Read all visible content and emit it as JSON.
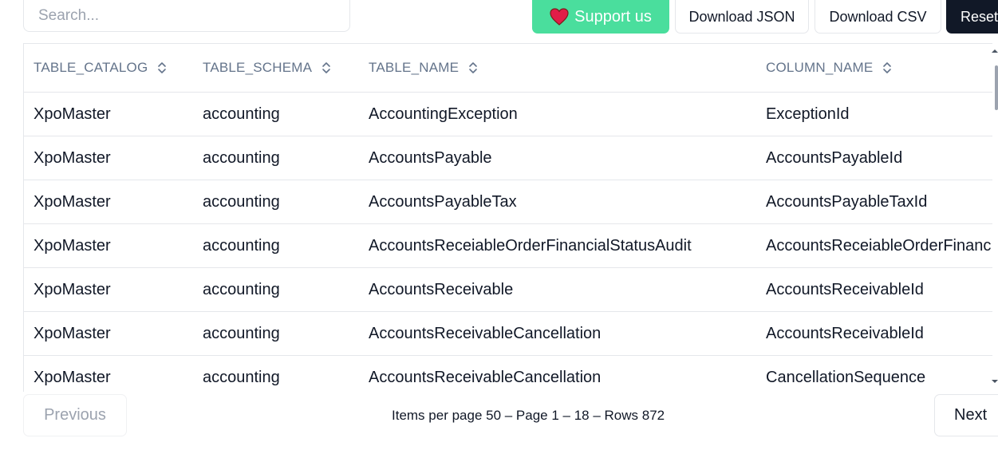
{
  "search": {
    "placeholder": "Search..."
  },
  "toolbar": {
    "support_label": "Support us",
    "download_json_label": "Download JSON",
    "download_csv_label": "Download CSV",
    "reset_label": "Reset",
    "support_color": "#4ade9d",
    "heart_color": "#e11d48"
  },
  "table": {
    "columns": [
      "TABLE_CATALOG",
      "TABLE_SCHEMA",
      "TABLE_NAME",
      "COLUMN_NAME"
    ],
    "rows": [
      [
        "XpoMaster",
        "accounting",
        "AccountingException",
        "ExceptionId"
      ],
      [
        "XpoMaster",
        "accounting",
        "AccountsPayable",
        "AccountsPayableId"
      ],
      [
        "XpoMaster",
        "accounting",
        "AccountsPayableTax",
        "AccountsPayableTaxId"
      ],
      [
        "XpoMaster",
        "accounting",
        "AccountsReceiableOrderFinancialStatusAudit",
        "AccountsReceiableOrderFinanc"
      ],
      [
        "XpoMaster",
        "accounting",
        "AccountsReceivable",
        "AccountsReceivableId"
      ],
      [
        "XpoMaster",
        "accounting",
        "AccountsReceivableCancellation",
        "AccountsReceivableId"
      ],
      [
        "XpoMaster",
        "accounting",
        "AccountsReceivableCancellation",
        "CancellationSequence"
      ]
    ]
  },
  "pagination": {
    "previous_label": "Previous",
    "info": "Items per page 50 – Page 1 – 18 – Rows 872",
    "next_label": "Next"
  }
}
